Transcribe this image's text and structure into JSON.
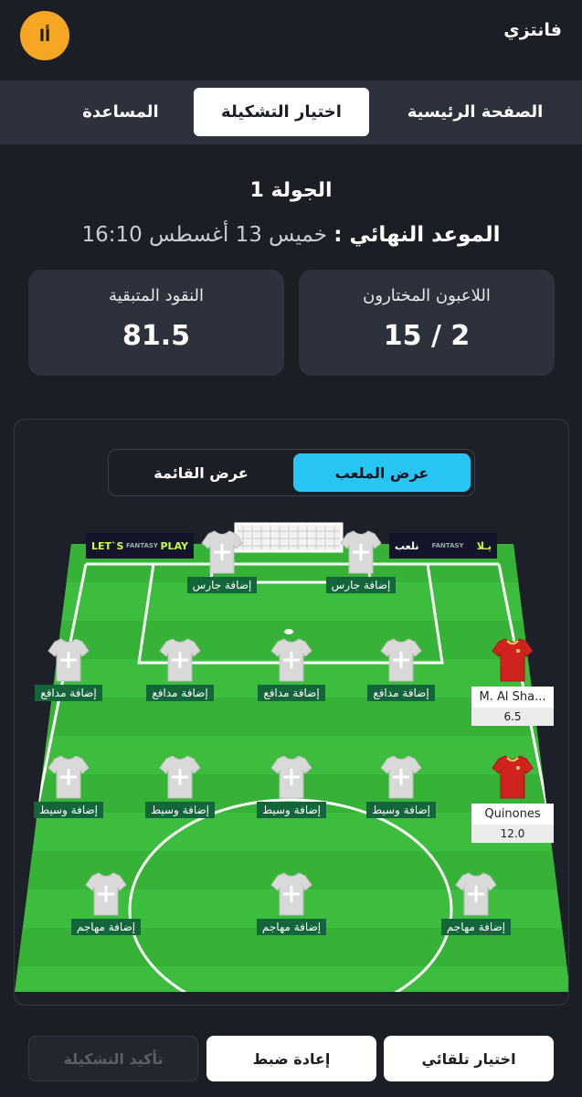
{
  "header": {
    "brand": "فانتزي",
    "lang_button": "أا"
  },
  "tabs": [
    {
      "label": "الصفحة الرئيسية",
      "active": false
    },
    {
      "label": "اختيار التشكيلة",
      "active": true
    },
    {
      "label": "المساعدة",
      "active": false
    }
  ],
  "round": {
    "title": "الجولة 1",
    "deadline_label": "الموعد النهائي :",
    "deadline_value": "خميس 13 أغسطس 16:10"
  },
  "stats": {
    "selected": {
      "label": "اللاعبون المختارون",
      "value": "15 / 2"
    },
    "money": {
      "label": "النقود المتبقية",
      "value": "81.5"
    }
  },
  "view_toggle": {
    "pitch": "عرض الملعب",
    "list": "عرض القائمة",
    "active": "pitch"
  },
  "banners": {
    "left": {
      "a": "LET`S",
      "b": "PLAY",
      "c": "FANTASY"
    },
    "right": {
      "a": "يـلا",
      "b": "نلعب",
      "c": "FANTASY"
    }
  },
  "pitch": {
    "goalkeepers": [
      "إضافة جارس",
      "إضافة جارس"
    ],
    "defenders": [
      "إضافة مدافع",
      "إضافة مدافع",
      "إضافة مدافع",
      "إضافة مدافع"
    ],
    "midfielders": [
      "إضافة وسيط",
      "إضافة وسيط",
      "إضافة وسيط",
      "إضافة وسيط"
    ],
    "forwards": [
      "إضافة مهاجم",
      "إضافة مهاجم",
      "إضافة مهاجم"
    ],
    "selected_defender": {
      "name": "M. Al Sha...",
      "price": "6.5"
    },
    "selected_midfielder": {
      "name": "Quinones",
      "price": "12.0"
    }
  },
  "colors": {
    "pitch_light": "#3dbd3d",
    "pitch_dark": "#35b035",
    "accent": "#29c5f2",
    "lang": "#f5a623",
    "red_kit": "#d0231f"
  },
  "actions": {
    "auto_pick": "اختيار تلقائي",
    "reset": "إعادة ضبط",
    "confirm": "تأكيد التشكيلة"
  }
}
